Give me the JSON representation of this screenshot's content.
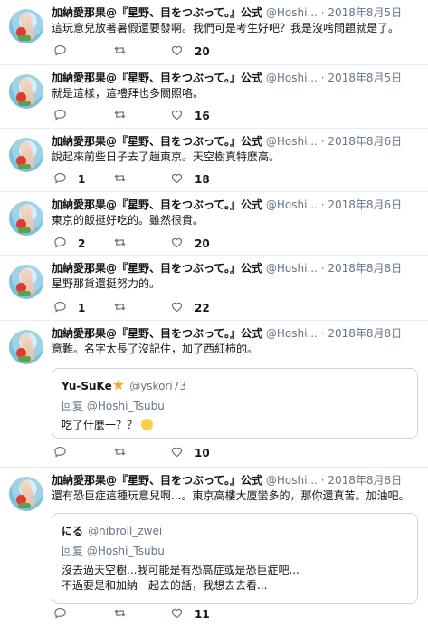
{
  "tweets": [
    {
      "name": "加納愛那果@『星野、目をつぶって。』公式",
      "handle": "@Hoshi...",
      "date": "2018年8月5日",
      "text": "這玩意兒放著暑假還要發啊。我們可是考生好吧？我是沒啥問題就是了。",
      "reply": "",
      "retweet": "",
      "like": "20"
    },
    {
      "name": "加納愛那果@『星野、目をつぶって。』公式",
      "handle": "@Hoshi...",
      "date": "2018年8月5日",
      "text": "就是這樣，這禮拜也多關照咯。",
      "reply": "",
      "retweet": "",
      "like": "16"
    },
    {
      "name": "加納愛那果@『星野、目をつぶって。』公式",
      "handle": "@Hoshi...",
      "date": "2018年8月6日",
      "text": "說起來前些日子去了趟東京。天空樹真特麼高。",
      "reply": "1",
      "retweet": "",
      "like": "18"
    },
    {
      "name": "加納愛那果@『星野、目をつぶって。』公式",
      "handle": "@Hoshi...",
      "date": "2018年8月6日",
      "text": "東京的飯挺好吃的。雖然很貴。",
      "reply": "2",
      "retweet": "",
      "like": "20"
    },
    {
      "name": "加納愛那果@『星野、目をつぶって。』公式",
      "handle": "@Hoshi...",
      "date": "2018年8月8日",
      "text": "星野那貨還挺努力的。",
      "reply": "1",
      "retweet": "",
      "like": "22"
    },
    {
      "name": "加納愛那果@『星野、目をつぶって。』公式",
      "handle": "@Hoshi...",
      "date": "2018年8月8日",
      "text": "意難。名字太長了沒記住，加了西紅柿的。",
      "reply": "",
      "retweet": "",
      "like": "10",
      "quote": {
        "name": "Yu-SuKe",
        "handle": "@yskori73",
        "reply_prefix": "回复",
        "reply_to": "@Hoshi_Tsubu",
        "text": "吃了什麼一？？"
      }
    },
    {
      "name": "加納愛那果@『星野、目をつぶって。』公式",
      "handle": "@Hoshi...",
      "date": "2018年8月8日",
      "text": "還有恐巨症這種玩意兒啊...。東京高樓大廈蠻多的，那你還真苦。加油吧。",
      "reply": "",
      "retweet": "",
      "like": "11",
      "quote": {
        "name": "にる",
        "handle": "@nibroll_zwei",
        "reply_prefix": "回复",
        "reply_to": "@Hoshi_Tsubu",
        "text": "沒去過天空樹...我可能是有恐高症或是恐巨症吧...",
        "text2": "不過要是和加納一起去的話，我想去去看..."
      }
    }
  ],
  "icons": {
    "reply": "reply-icon",
    "retweet": "retweet-icon",
    "like": "heart-icon"
  },
  "colors": {
    "muted": "#657786",
    "text": "#14171a",
    "border": "#e6ecf0",
    "star": "#f5a623"
  }
}
